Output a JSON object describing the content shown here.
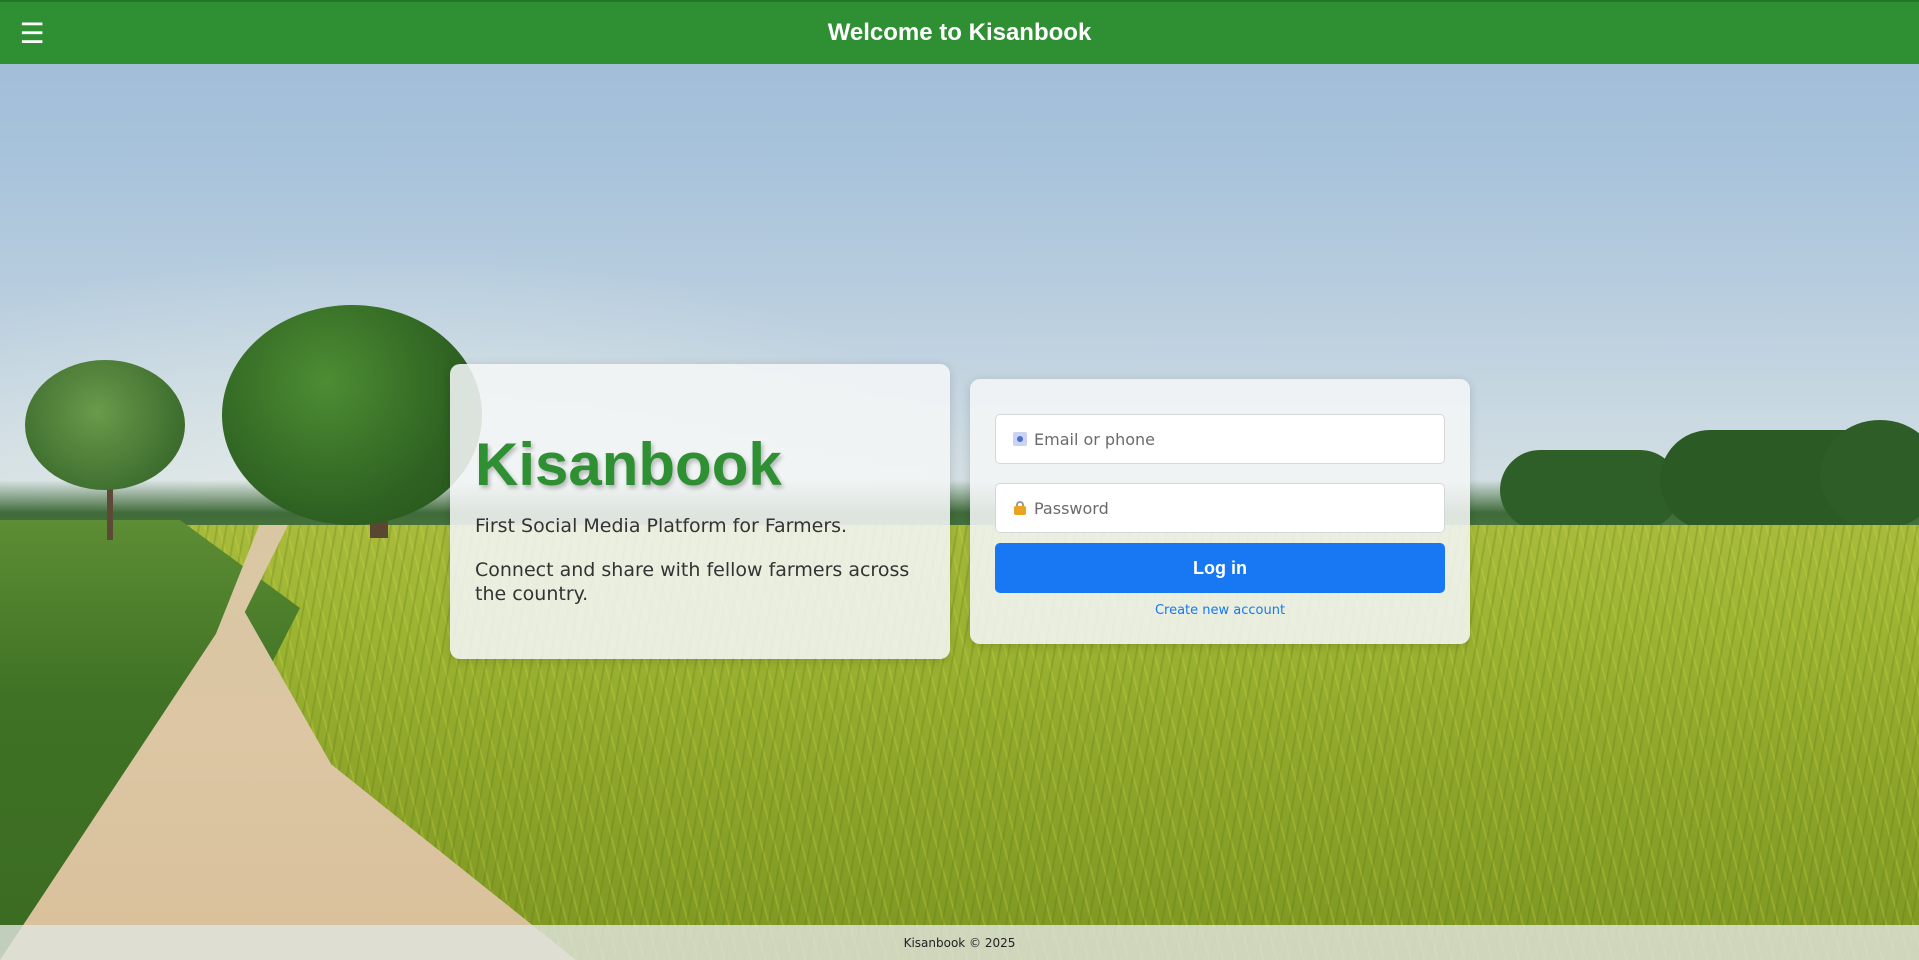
{
  "header": {
    "menu_icon": "☰",
    "title": "Welcome to Kisanbook"
  },
  "brand": {
    "name": "Kisanbook",
    "tagline": "First Social Media Platform for Farmers.",
    "description": "Connect and share with fellow farmers across the country."
  },
  "login": {
    "email_placeholder": "Email or phone",
    "password_placeholder": "Password",
    "login_label": "Log in",
    "create_account_label": "Create new account"
  },
  "footer": {
    "text": "Kisanbook © 2025"
  },
  "icons": {
    "menu": "hamburger-menu-icon",
    "email": "mail-icon",
    "password": "lock-icon"
  },
  "colors": {
    "header_bg": "#2e8f33",
    "brand_green": "#2e8f33",
    "login_button": "#1877f2",
    "link": "#1877f2"
  }
}
